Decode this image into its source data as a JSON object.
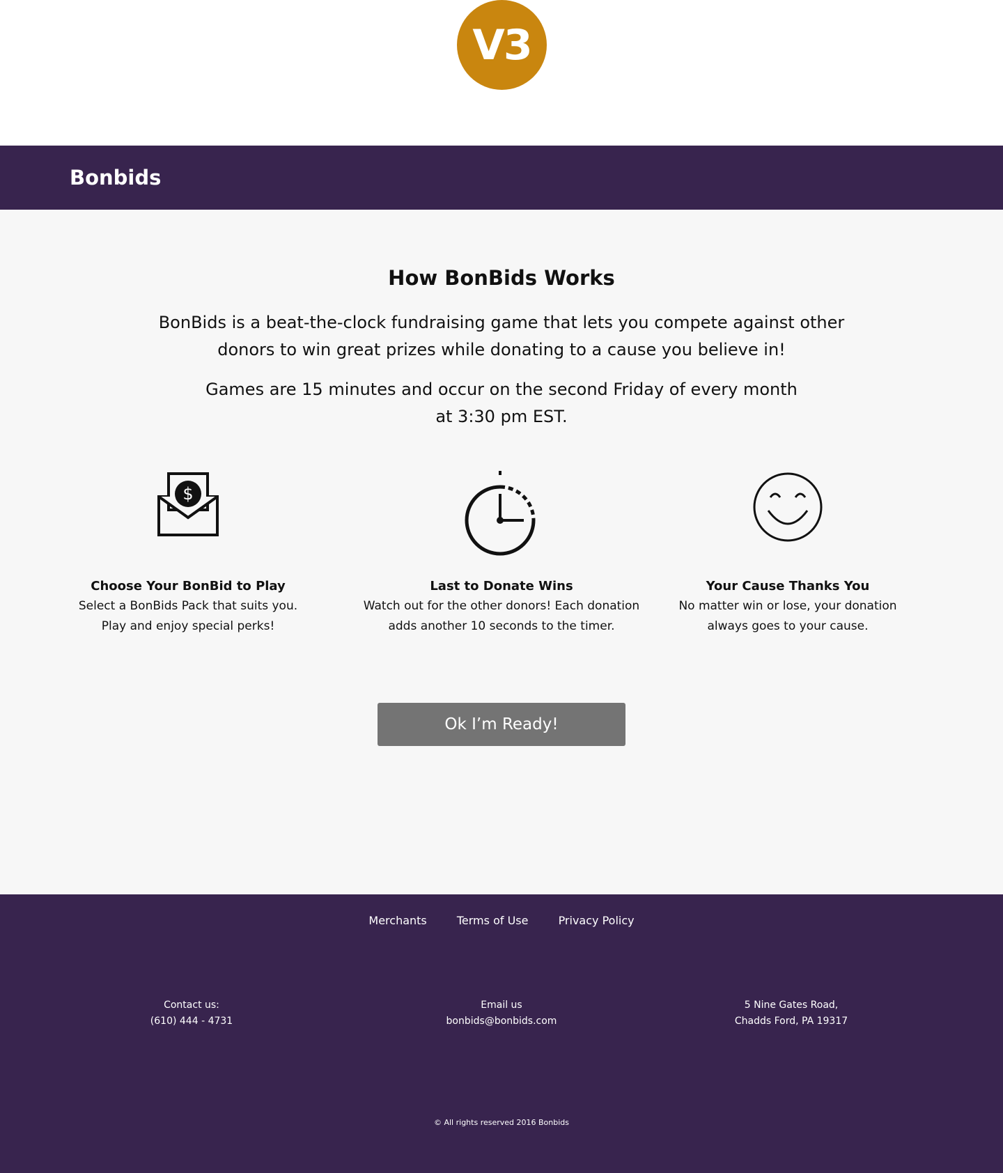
{
  "badge": {
    "label": "V3",
    "color": "#c9860f"
  },
  "navbar": {
    "brand": "Bonbids",
    "background": "#38244e"
  },
  "main": {
    "title": "How BonBids Works",
    "intro_line1": "BonBids is a beat-the-clock fundraising game that lets you compete against other",
    "intro_line2": "donors to win great prizes while donating to a cause you believe in!",
    "schedule_line1": "Games are 15 minutes and occur on the second Friday of every month",
    "schedule_line2": "at 3:30 pm EST.",
    "features": [
      {
        "icon": "envelope-dollar-icon",
        "title": "Choose Your BonBid to Play",
        "desc_line1": "Select a BonBids Pack that suits you.",
        "desc_line2": "Play and enjoy special perks!"
      },
      {
        "icon": "stopwatch-icon",
        "title": "Last to Donate Wins",
        "desc_line1": "Watch out for the other donors! Each donation",
        "desc_line2": "adds another 10 seconds to the timer."
      },
      {
        "icon": "smiley-face-icon",
        "title": "Your Cause Thanks You",
        "desc_line1": "No matter win or lose, your donation",
        "desc_line2": "always goes to your cause."
      }
    ],
    "cta_label": "Ok I’m Ready!"
  },
  "footer": {
    "links": [
      "Merchants",
      "Terms of Use",
      "Privacy Policy"
    ],
    "contact_label": "Contact us:",
    "contact_phone": "(610) 444 - 4731",
    "email_label": "Email us",
    "email_address": "bonbids@bonbids.com",
    "address_line1": "5 Nine Gates Road,",
    "address_line2": "Chadds Ford, PA 19317",
    "copyright": "© All rights reserved 2016 Bonbids"
  }
}
